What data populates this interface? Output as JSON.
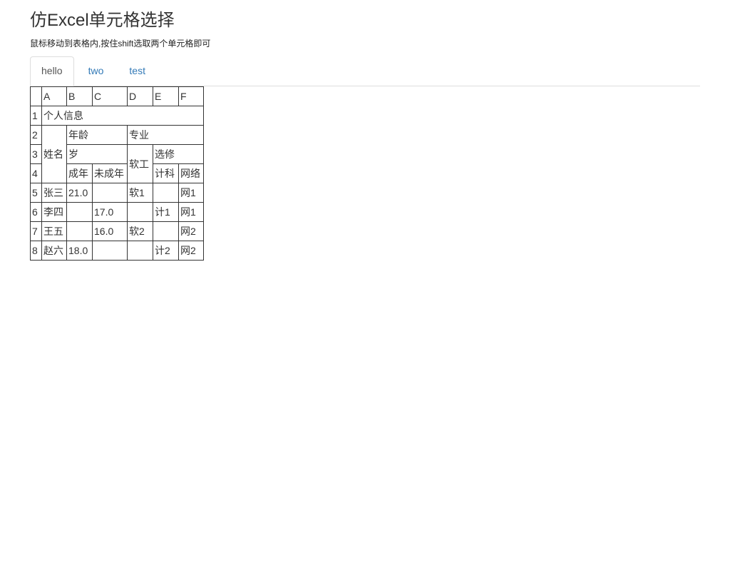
{
  "page": {
    "title": "仿Excel单元格选择",
    "hint": "鼠标移动到表格内,按住shift选取两个单元格即可"
  },
  "tabs": [
    {
      "label": "hello",
      "active": true
    },
    {
      "label": "two",
      "active": false
    },
    {
      "label": "test",
      "active": false
    }
  ],
  "sheet": {
    "columns": [
      "",
      "A",
      "B",
      "C",
      "D",
      "E",
      "F"
    ],
    "row_numbers": [
      "1",
      "2",
      "3",
      "4",
      "5",
      "6",
      "7",
      "8"
    ],
    "header": {
      "personal_info": "个人信息",
      "name": "姓名",
      "age": "年龄",
      "major": "专业",
      "years": "岁",
      "software": "软工",
      "elective": "选修",
      "adult": "成年",
      "minor": "未成年",
      "cs": "计科",
      "network": "网络"
    },
    "rows": [
      [
        "张三",
        "21.0",
        "",
        "软1",
        "",
        "网1"
      ],
      [
        "李四",
        "",
        "17.0",
        "",
        "计1",
        "网1"
      ],
      [
        "王五",
        "",
        "16.0",
        "软2",
        "",
        "网2"
      ],
      [
        "赵六",
        "18.0",
        "",
        "",
        "计2",
        "网2"
      ]
    ]
  }
}
